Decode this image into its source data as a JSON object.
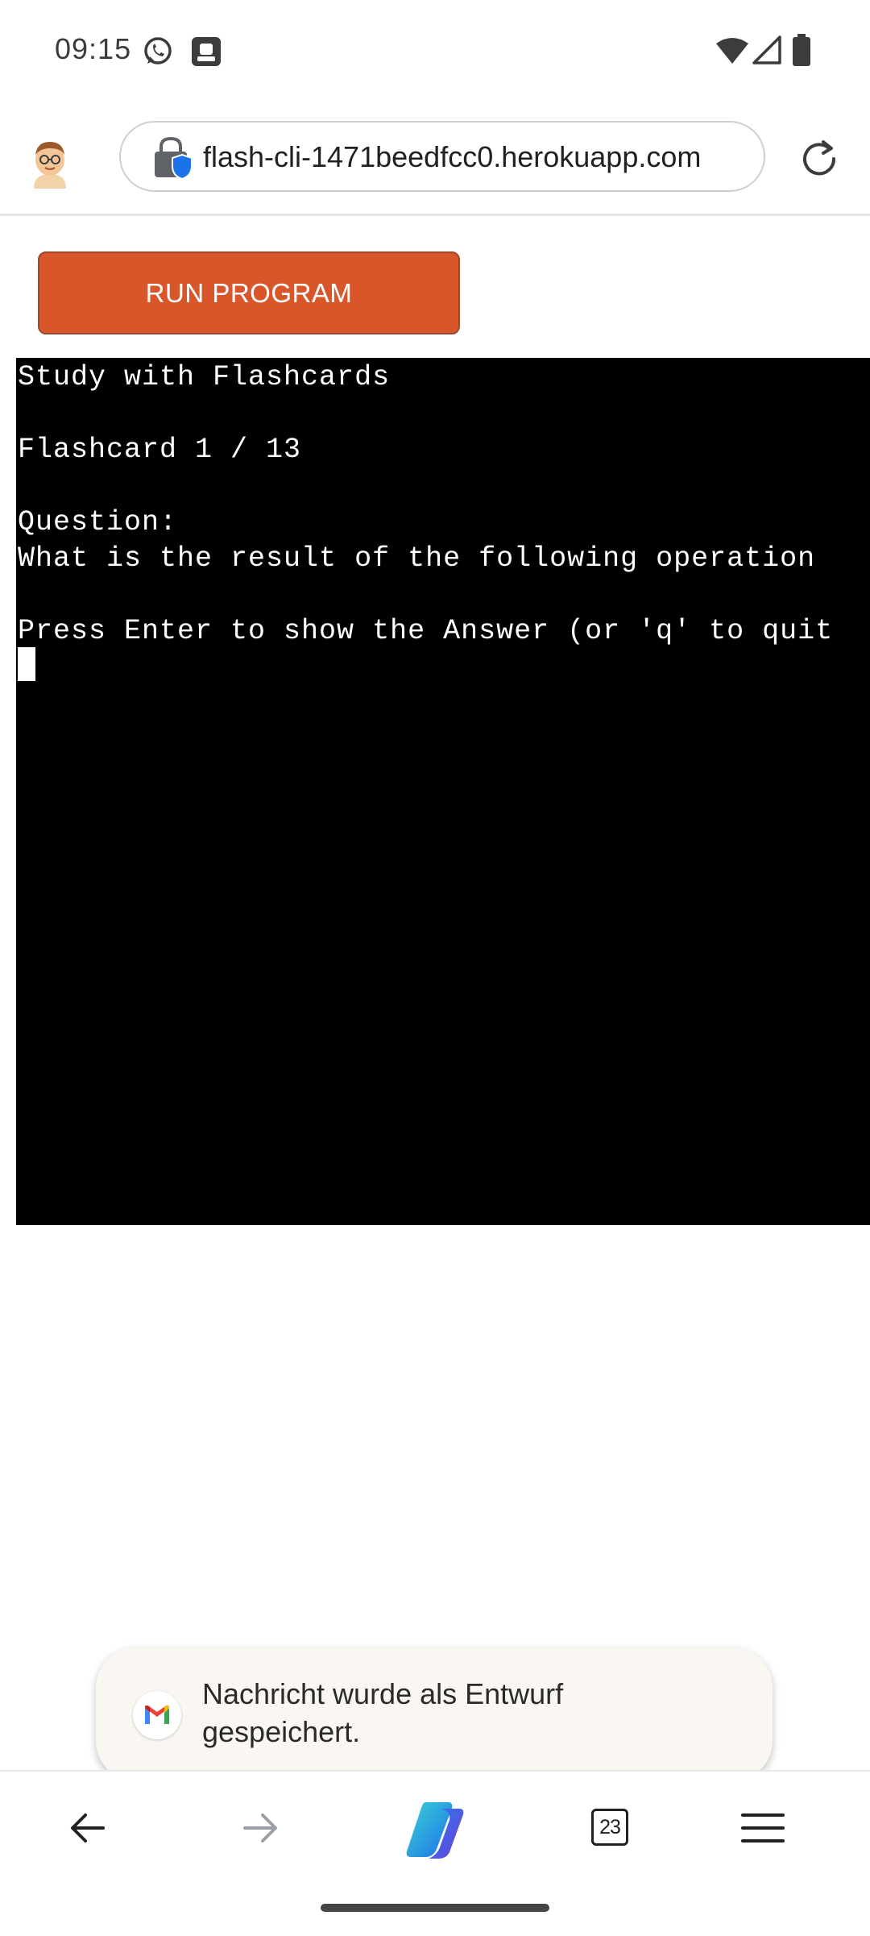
{
  "status_bar": {
    "time": "09:15",
    "icons": [
      "whatsapp-icon",
      "notification-app-icon",
      "wifi-icon",
      "signal-icon",
      "battery-icon"
    ]
  },
  "browser": {
    "url": "flash-cli-1471beedfcc0.herokuapp.com",
    "icons": [
      "profile-avatar",
      "lock-shield-icon",
      "reload-icon"
    ]
  },
  "page": {
    "run_button_label": "RUN PROGRAM",
    "accent_color": "#d9562b"
  },
  "terminal": {
    "lines": [
      "Study with Flashcards",
      "",
      "Flashcard 1 / 13",
      "",
      "Question:",
      "What is the result of the following operation",
      "",
      "Press Enter to show the Answer (or 'q' to quit"
    ],
    "background": "#000000",
    "foreground": "#ffffff"
  },
  "toast": {
    "message": "Nachricht wurde als Entwurf gespeichert.",
    "icon": "gmail-icon"
  },
  "bottom_nav": {
    "tab_count": "23",
    "items": [
      "back-icon",
      "forward-icon",
      "copilot-icon",
      "tabs-icon",
      "menu-icon"
    ]
  }
}
